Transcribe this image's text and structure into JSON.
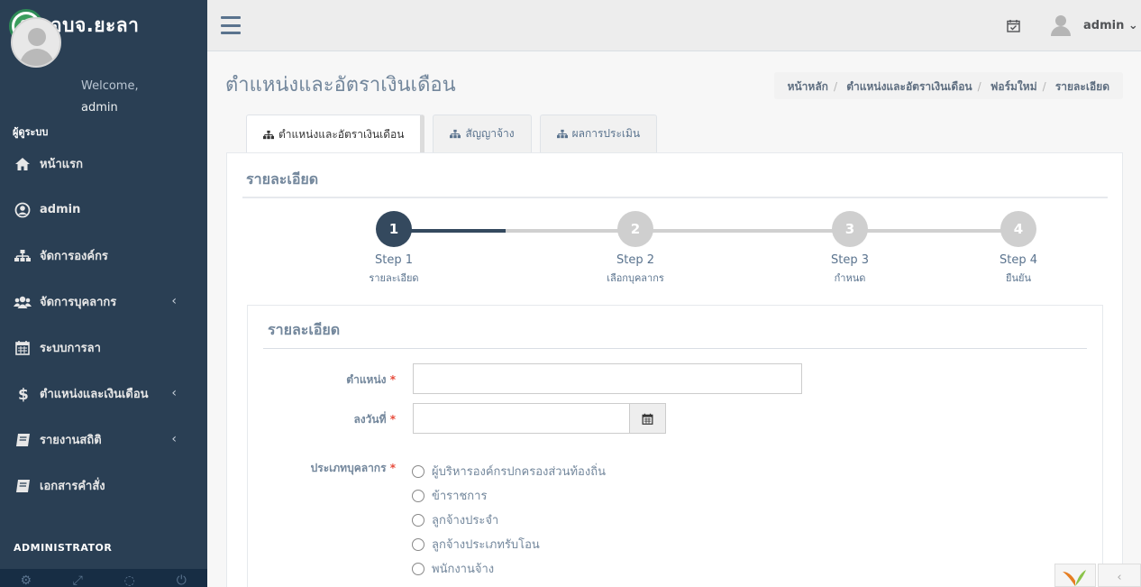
{
  "brand": {
    "title": "อบจ.ยะลา"
  },
  "profile": {
    "welcome": "Welcome,",
    "name": "admin",
    "role": "ผู้ดูระบบ"
  },
  "menu": [
    {
      "label": "หน้าแรก",
      "icon": "home-icon",
      "chevron": false
    },
    {
      "label": "admin",
      "icon": "user-circle-icon",
      "chevron": false
    },
    {
      "label": "จัดการองค์กร",
      "icon": "sitemap-icon",
      "chevron": true
    },
    {
      "label": "จัดการบุคลากร",
      "icon": "users-icon",
      "chevron": true
    },
    {
      "label": "ระบบการลา",
      "icon": "calendar-icon",
      "chevron": false
    },
    {
      "label": "ตำแหน่งและเงินเดือน",
      "icon": "dollar-icon",
      "chevron": true
    },
    {
      "label": "รายงานสถิติ",
      "icon": "book-icon",
      "chevron": true
    },
    {
      "label": "เอกสารคำสั่ง",
      "icon": "book-icon",
      "chevron": false
    }
  ],
  "sidebar_section": "ADMINISTRATOR",
  "chevron": "‹",
  "topnav": {
    "user": "admin",
    "caret": "⌄"
  },
  "page": {
    "title": "ตำแหน่งและอัตราเงินเดือน"
  },
  "breadcrumb": {
    "items": [
      "หน้าหลัก",
      "ตำแหน่งและอัตราเงินเดือน",
      "ฟอร์มใหม่",
      "รายละเอียด"
    ],
    "sep": "/"
  },
  "tabs": [
    {
      "label": "ตำแหน่งและอัตราเงินเดือน",
      "active": true
    },
    {
      "label": "สัญญาจ้าง",
      "active": false
    },
    {
      "label": "ผลการประเมิน",
      "active": false
    }
  ],
  "panel": {
    "title": "รายละเอียด"
  },
  "wizard": {
    "current": 1,
    "steps": [
      {
        "number": "1",
        "title": "Step 1",
        "desc": "รายละเอียด"
      },
      {
        "number": "2",
        "title": "Step 2",
        "desc": "เลือกบุคลากร"
      },
      {
        "number": "3",
        "title": "Step 3",
        "desc": "กำหนด"
      },
      {
        "number": "4",
        "title": "Step 4",
        "desc": "ยืนยัน"
      }
    ]
  },
  "form": {
    "title": "รายละเอียด",
    "required_mark": "*",
    "position_label": "ตำแหน่ง",
    "position_value": "",
    "date_label": "ลงวันที่",
    "date_value": "",
    "type_label": "ประเภทบุคลากร",
    "types": [
      "ผู้บริหารองค์กรปกครองส่วนท้องถิ่น",
      "ข้าราชการ",
      "ลูกจ้างประจำ",
      "ลูกจ้างประเภทรับโอน",
      "พนักงานจ้าง"
    ]
  },
  "colors": {
    "sidebar": "#2a3f54",
    "active_step": "#34495e",
    "required": "#e74c3c"
  }
}
